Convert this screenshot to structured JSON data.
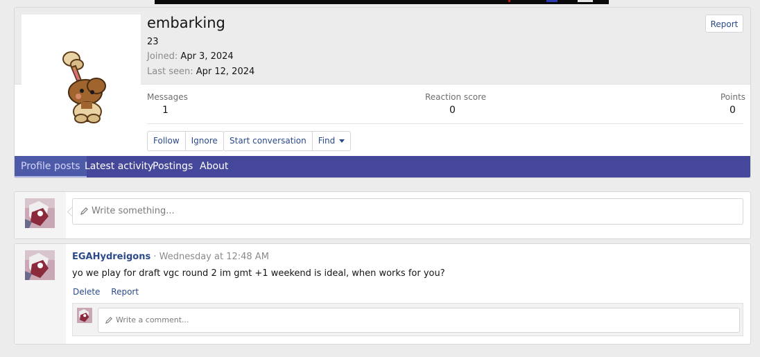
{
  "profile": {
    "username": "embarking",
    "custom_title": "23",
    "joined_label": "Joined:",
    "joined_value": "Apr 3, 2024",
    "last_seen_label": "Last seen:",
    "last_seen_value": "Apr 12, 2024",
    "report_label": "Report"
  },
  "stats": {
    "messages_label": "Messages",
    "messages_value": "1",
    "reaction_label": "Reaction score",
    "reaction_value": "0",
    "points_label": "Points",
    "points_value": "0"
  },
  "actions": {
    "follow": "Follow",
    "ignore": "Ignore",
    "start_conversation": "Start conversation",
    "find": "Find"
  },
  "tabs": [
    {
      "label": "Profile posts",
      "active": true
    },
    {
      "label": "Latest activity",
      "active": false
    },
    {
      "label": "Postings",
      "active": false
    },
    {
      "label": "About",
      "active": false
    }
  ],
  "composer": {
    "placeholder": "Write something..."
  },
  "post": {
    "author": "EGAHydreigons",
    "separator": "·",
    "time": "Wednesday at 12:48 AM",
    "body": "yo we play for draft vgc round 2 im gmt +1 weekend is ideal, when works for you?",
    "delete_label": "Delete",
    "report_label": "Report",
    "comment_placeholder": "Write a comment..."
  },
  "colors": {
    "nav_bg": "#45479a",
    "link": "#2b4a8a",
    "page_bg": "#ececec"
  }
}
